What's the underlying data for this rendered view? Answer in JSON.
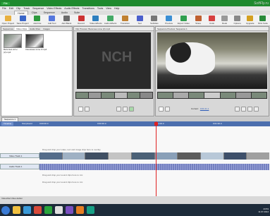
{
  "titlebar": {
    "title": "File",
    "watermark": "SoftFly.ru"
  },
  "menu": [
    "File",
    "Edit",
    "Clip",
    "Track",
    "Sequence",
    "Video Effects",
    "Audio Effects",
    "Transitions",
    "Tools",
    "View",
    "Help"
  ],
  "tabs": [
    {
      "label": "Home",
      "active": true
    },
    {
      "label": "Clips",
      "active": false
    },
    {
      "label": "Sequence",
      "active": false
    },
    {
      "label": "Audio",
      "active": false
    },
    {
      "label": "Suite",
      "active": false
    }
  ],
  "ribbon": [
    {
      "label": "Open Project",
      "color": "#e8b040"
    },
    {
      "label": "Save Project",
      "color": "#3a66c8"
    },
    {
      "label": "Add File",
      "color": "#2e9a3e"
    },
    {
      "label": "Add Text",
      "color": "#5577dd"
    },
    {
      "label": "Add Blank",
      "color": "#6a6a6a"
    },
    {
      "label": "Record",
      "color": "#cc3333"
    },
    {
      "label": "Video Effects",
      "color": "#2e7fbf"
    },
    {
      "label": "Audio Effects",
      "color": "#44aa66"
    },
    {
      "label": "Transition",
      "color": "#c08030"
    },
    {
      "label": "Text",
      "color": "#4a5fcc"
    },
    {
      "label": "Subtitles",
      "color": "#777777"
    },
    {
      "label": "Preview",
      "color": "#3b8fd4"
    },
    {
      "label": "Export Video",
      "color": "#2f9f4f"
    },
    {
      "label": "Share",
      "color": "#c06030"
    },
    {
      "label": "Undo",
      "color": "#d64040"
    },
    {
      "label": "Redo",
      "color": "#999999"
    },
    {
      "label": "Options",
      "color": "#888888"
    },
    {
      "label": "Upgrade",
      "color": "#d4a020"
    },
    {
      "label": "NCH Suite",
      "color": "#2a8a3a"
    }
  ],
  "bin": {
    "tabs": [
      {
        "label": "Sequences",
        "active": false
      },
      {
        "label": "Video Clips",
        "active": true
      },
      {
        "label": "Audio Files",
        "active": false
      },
      {
        "label": "Images",
        "active": false
      }
    ],
    "clips": [
      "Веселые коты (2).mp4",
      "Смешные коты 2.mp4"
    ]
  },
  "clip_preview": {
    "title": "Clip Preview: Веселые коты (2).mp4",
    "logo": "NCH"
  },
  "seq_preview": {
    "title": "Sequence Preview: Sequence 1",
    "current_label": "Current:",
    "current_time": "0:01:21.1"
  },
  "sequence": {
    "tab": "Sequence 1"
  },
  "timeline": {
    "timeline_button": "Timeline",
    "storyboard_button": "Storyboard",
    "ruler": [
      "0:00:00.0",
      "0:00:30.0",
      "0:01:00.0",
      "0:01:30.0",
      "0:02:00.0"
    ],
    "video_track": "Video Track 1",
    "overlay_hint": "Drag and drop your video, text and image clips here to overlay",
    "audio_track": "Audio Track 1",
    "audio_hint": "Drag and drop your sound clips here to mix",
    "audio_hint2": "Drag and drop your sound clips here to mix"
  },
  "status": {
    "text": "VideoPad Video Editor"
  },
  "taskbar": {
    "time": "23:53",
    "date": "11.07.2014"
  }
}
